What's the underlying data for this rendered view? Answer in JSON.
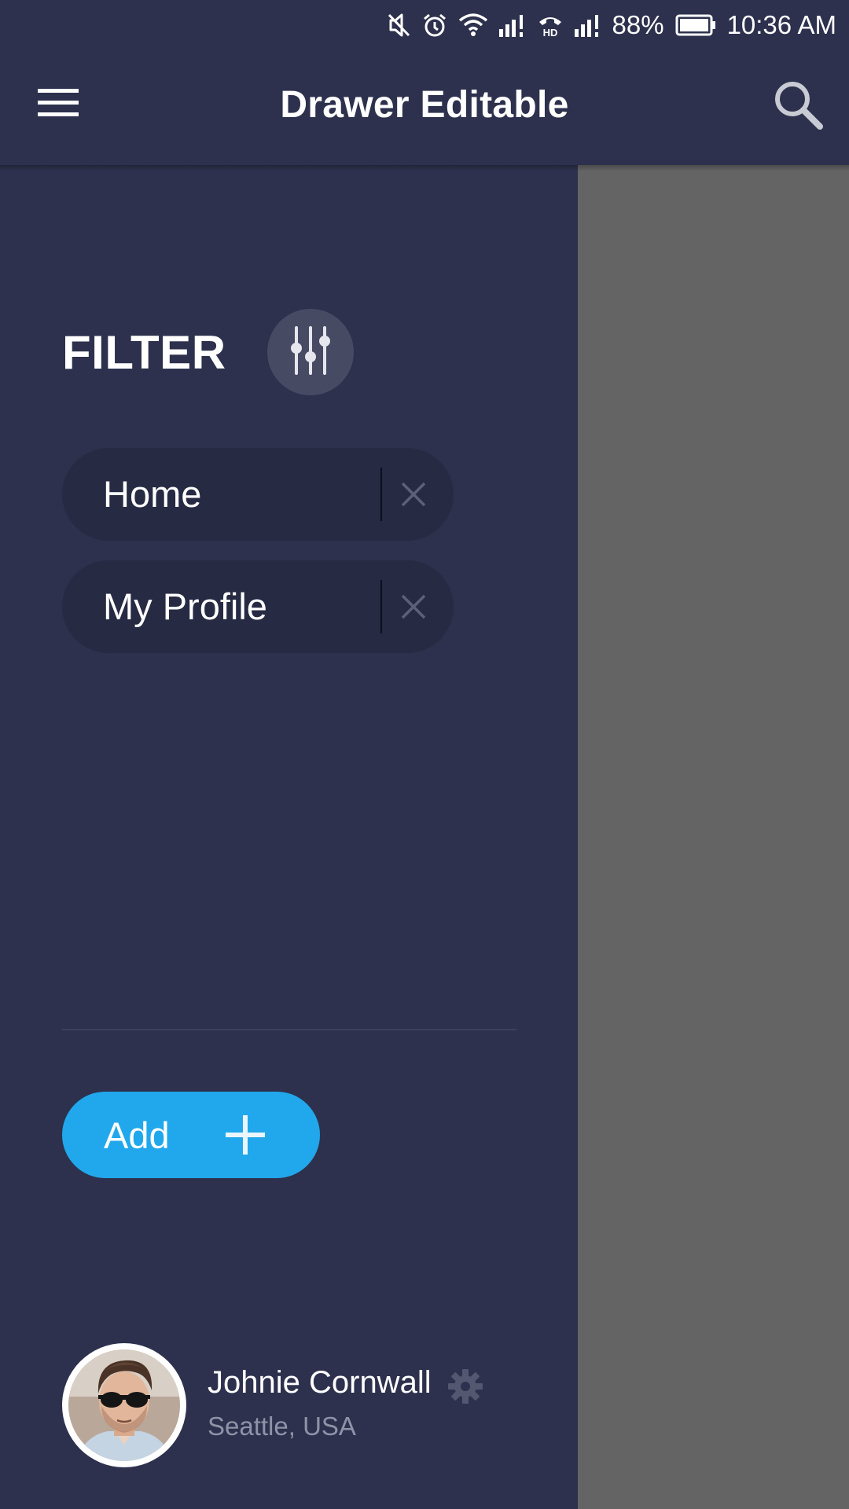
{
  "status_bar": {
    "battery": "88%",
    "time": "10:36 AM",
    "network_badge": "HD"
  },
  "app_bar": {
    "title": "Drawer Editable",
    "menu_icon": "menu-icon",
    "search_icon": "search-icon"
  },
  "drawer": {
    "filter_title": "FILTER",
    "filter_icon": "sliders-icon",
    "chips": [
      {
        "label": "Home"
      },
      {
        "label": "My Profile"
      }
    ],
    "add_button": {
      "label": "Add",
      "icon": "plus-icon"
    },
    "profile": {
      "name": "Johnie Cornwall",
      "location": "Seattle, USA",
      "settings_icon": "gear-icon"
    }
  },
  "colors": {
    "background": "#2d314d",
    "chip_background": "#262a43",
    "accent": "#21a8ec",
    "scrim": "#646464",
    "muted_text": "#8f93a8"
  }
}
